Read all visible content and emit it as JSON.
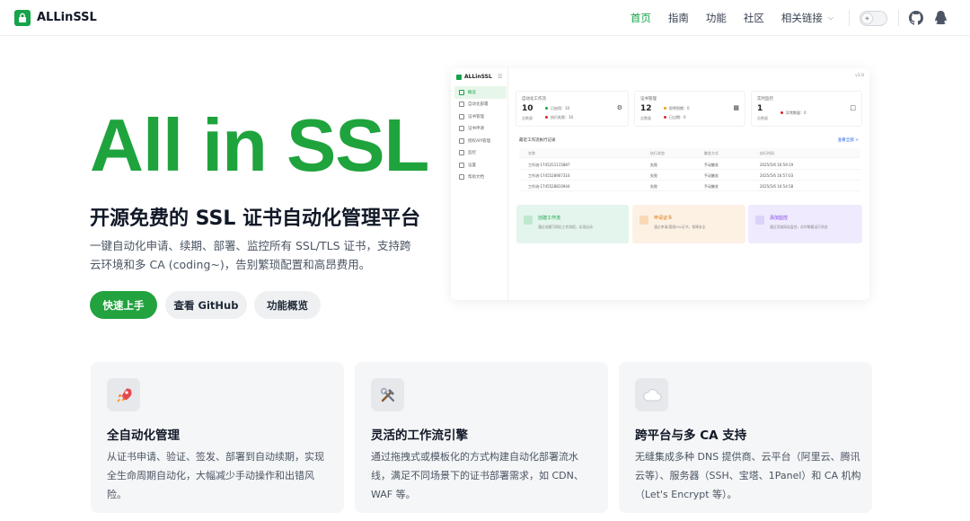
{
  "header": {
    "brand": "ALLinSSL",
    "nav": [
      {
        "label": "首页",
        "active": true
      },
      {
        "label": "指南",
        "active": false
      },
      {
        "label": "功能",
        "active": false
      },
      {
        "label": "社区",
        "active": false
      },
      {
        "label": "相关链接",
        "active": false,
        "dropdown": true
      }
    ],
    "icons": [
      "theme-toggle-icon",
      "github-icon",
      "qq-icon"
    ]
  },
  "hero": {
    "title": "All in SSL",
    "subtitle": "开源免费的 SSL 证书自动化管理平台",
    "description": "一键自动化申请、续期、部署、监控所有 SSL/TLS 证书，支持跨云环境和多 CA (coding~)，告别繁琐配置和高昂费用。",
    "buttons": {
      "primary": "快速上手",
      "github": "查看 GitHub",
      "overview": "功能概览"
    }
  },
  "preview": {
    "brand": "ALLinSSL",
    "version": "v1.0",
    "menu": [
      "概览",
      "自动化部署",
      "证书管理",
      "证书申请",
      "授权API管理",
      "监控",
      "设置",
      "帮助文档"
    ],
    "cards": [
      {
        "title": "自动化工作流",
        "count": "10",
        "sub": "总数量",
        "row1": "已启用：10",
        "row2": "执行失败：10"
      },
      {
        "title": "证书管理",
        "count": "12",
        "sub": "总数量",
        "row1": "即将到期：0",
        "row2": "已过期：0"
      },
      {
        "title": "实时监控",
        "count": "1",
        "sub": "总数量",
        "row1": "异常数量：0",
        "row2": ""
      }
    ],
    "table": {
      "title": "最近工作流执行记录",
      "more": "查看全部 >",
      "columns": [
        "名称",
        "执行状态",
        "触发方式",
        "执行时间"
      ],
      "rows": [
        [
          "工作流-1745251115887",
          "失败",
          "手动触发",
          "2025/5/6 16:59:19"
        ],
        [
          "工作流-1745528907316",
          "失败",
          "手动触发",
          "2025/5/6 16:57:03"
        ],
        [
          "工作流-1745528810944",
          "失败",
          "手动触发",
          "2025/5/6 16:54:58"
        ]
      ]
    },
    "actions": [
      {
        "title": "创建工作流",
        "desc": "通过创建可视化工作流程，实现自动",
        "color": "#16a34a"
      },
      {
        "title": "申请证书",
        "desc": "通过申请/管理SSL证书，保障安全",
        "color": "#d97706"
      },
      {
        "title": "添加监控",
        "desc": "通过添加网站监控，实时掌握运行状态",
        "color": "#7c3aed"
      }
    ]
  },
  "features": [
    {
      "icon": "rocket-icon",
      "title": "全自动化管理",
      "desc": "从证书申请、验证、签发、部署到自动续期，实现全生命周期自动化，大幅减少手动操作和出错风险。"
    },
    {
      "icon": "tools-icon",
      "title": "灵活的工作流引擎",
      "desc": "通过拖拽式或模板化的方式构建自动化部署流水线，满足不同场景下的证书部署需求，如 CDN、WAF 等。"
    },
    {
      "icon": "cloud-icon",
      "title": "跨平台与多 CA 支持",
      "desc": "无缝集成多种 DNS 提供商、云平台（阿里云、腾讯云等）、服务器（SSH、宝塔、1Panel）和 CA 机构（Let's Encrypt 等）。"
    }
  ],
  "colors": {
    "accent": "#22a33f",
    "hero_title": "#1fa33d"
  }
}
